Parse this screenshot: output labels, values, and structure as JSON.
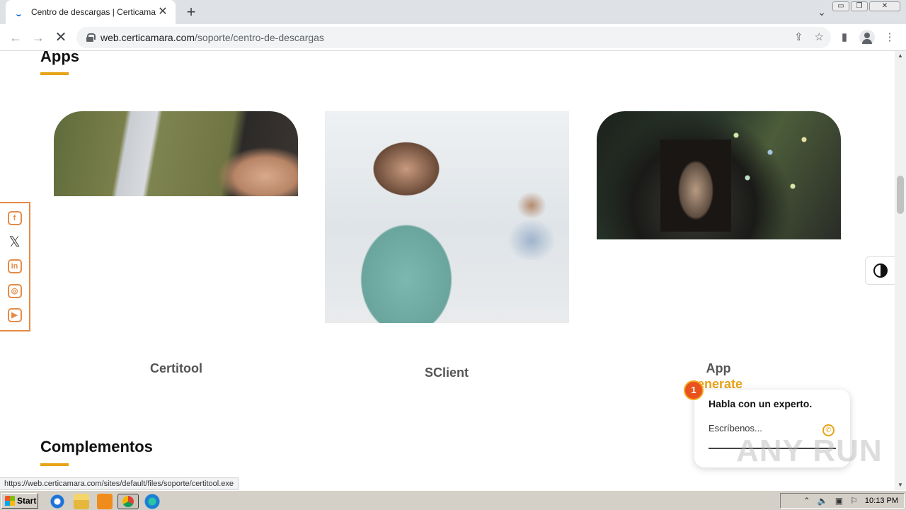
{
  "browser": {
    "tab_title": "Centro de descargas | Certicamara",
    "tab_close": "✕",
    "new_tab": "+",
    "url_host": "web.certicamara.com",
    "url_path": "/soporte/centro-de-descargas",
    "window_controls": [
      "▭",
      "❐",
      "✕"
    ]
  },
  "page": {
    "apps_title": "Apps",
    "complementos_title": "Complementos",
    "cards": [
      {
        "label": "Certitool",
        "image": "man-holding-phone"
      },
      {
        "label": "SClient",
        "image": "smiling-woman-with-tablet"
      },
      {
        "label": "App",
        "sublabel": "enerate",
        "image": "woman-looking-at-phone-at-night"
      }
    ]
  },
  "social": [
    "facebook-icon",
    "x-icon",
    "linkedin-icon",
    "instagram-icon",
    "youtube-icon"
  ],
  "chat": {
    "badge_count": "1",
    "title": "Habla con un experto.",
    "placeholder": "Escríbenos..."
  },
  "watermark": "ANY RUN",
  "status_url": "https://web.certicamara.com/sites/default/files/soporte/certitool.exe",
  "taskbar": {
    "start_label": "Start",
    "clock": "10:13 PM"
  },
  "colors": {
    "accent": "#e8a317",
    "social_border": "#e58b47",
    "chat_badge": "#e8531d"
  }
}
